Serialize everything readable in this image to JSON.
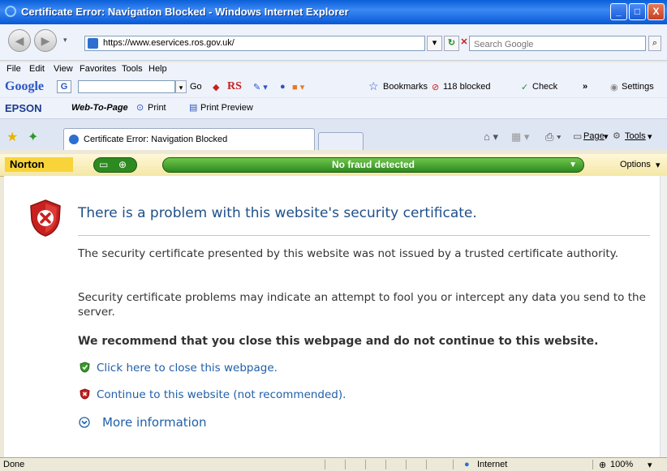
{
  "window": {
    "title": "Certificate Error: Navigation Blocked - Windows Internet Explorer",
    "controls": {
      "minimize": "_",
      "maximize": "□",
      "close": "X"
    }
  },
  "address": {
    "url": "https://www.eservices.ros.gov.uk/",
    "search_placeholder": "Search Google"
  },
  "menu": [
    "File",
    "Edit",
    "View",
    "Favorites",
    "Tools",
    "Help"
  ],
  "google_toolbar": {
    "logo": "Google",
    "go": "Go",
    "rs": "RS",
    "bookmarks": "Bookmarks",
    "blocked": "118 blocked",
    "check": "Check",
    "more": "»",
    "settings": "Settings"
  },
  "epson_toolbar": {
    "brand": "EPSON",
    "web_to_page": "Web-To-Page",
    "print": "Print",
    "print_preview": "Print Preview"
  },
  "tabs": {
    "active_label": "Certificate Error: Navigation Blocked",
    "command": {
      "page": "Page",
      "tools": "Tools"
    }
  },
  "norton": {
    "logo": "Norton",
    "fraud_status": "No fraud detected",
    "options": "Options"
  },
  "error_page": {
    "heading": "There is a problem with this website's security certificate.",
    "para1": "The security certificate presented by this website was not issued by a trusted certificate authority.",
    "para2": "Security certificate problems may indicate an attempt to fool you or intercept any data you send to the server.",
    "recommendation": "We recommend that you close this webpage and do not continue to this website.",
    "close_link": "Click here to close this webpage.",
    "continue_link": "Continue to this website (not recommended).",
    "more_info": "More information"
  },
  "status": {
    "left": "Done",
    "zone": "Internet",
    "zoom": "100%"
  },
  "colors": {
    "titlebar": "#0a5fd8",
    "heading": "#1f4f8a",
    "link": "#1f5fa8",
    "norton_green": "#2d8a20",
    "error_red": "#c8201e"
  }
}
